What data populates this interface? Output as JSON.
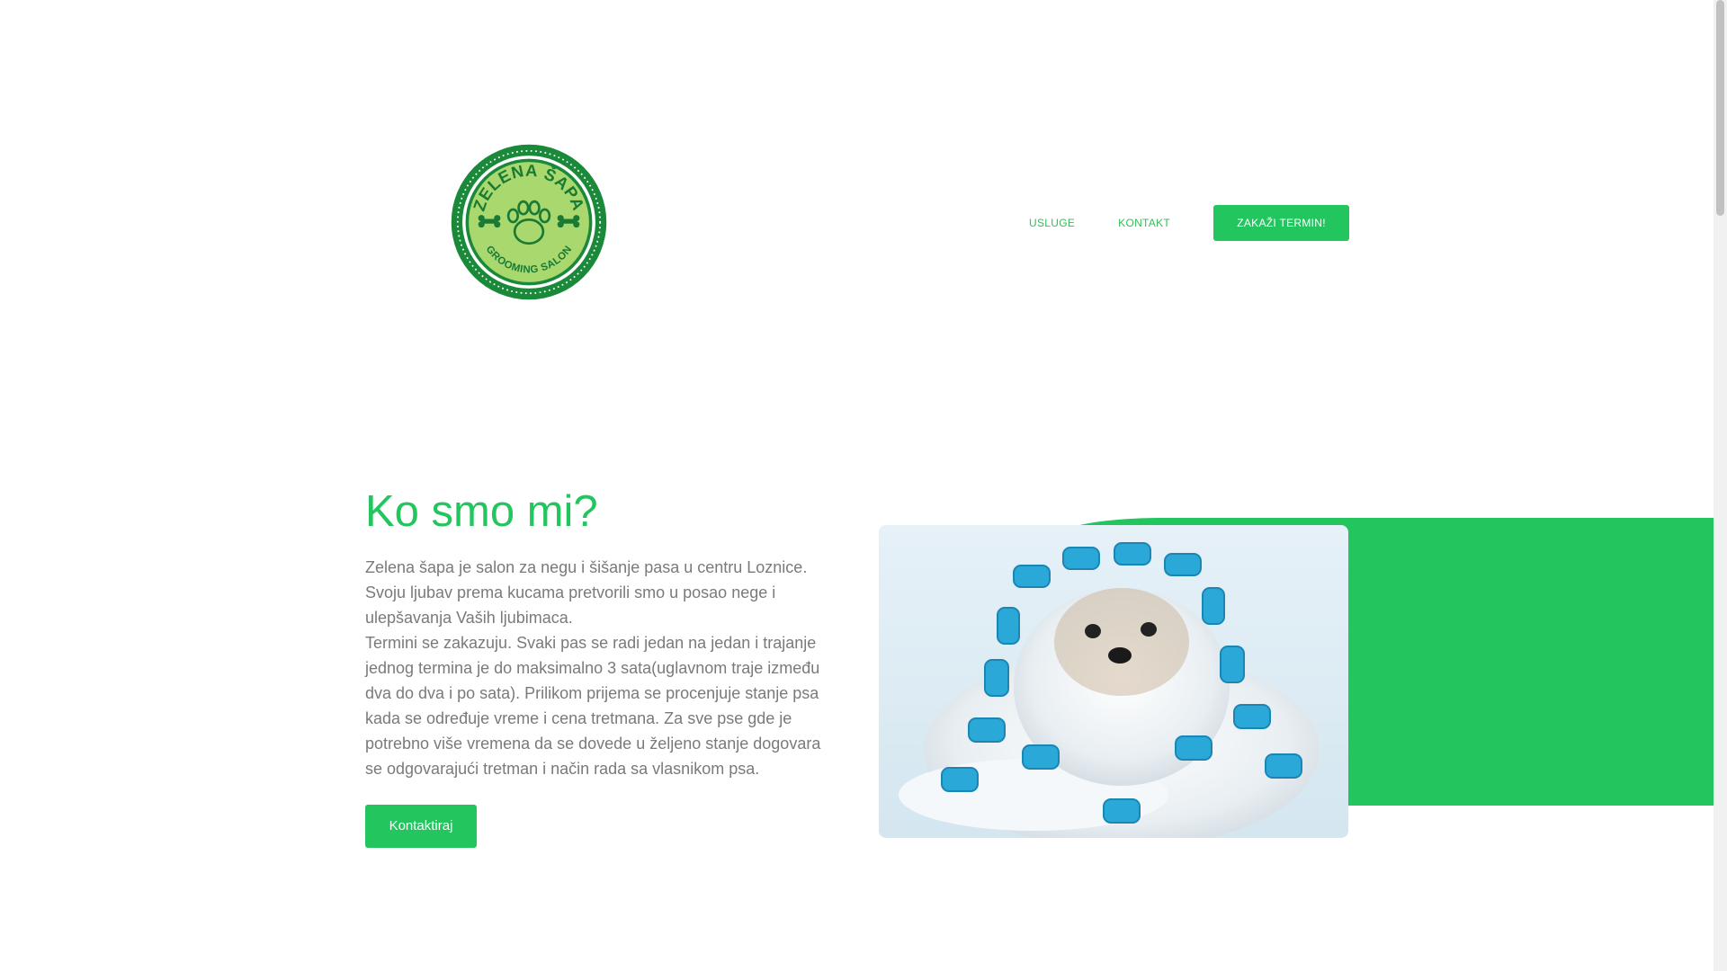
{
  "header": {
    "logo": {
      "icon": "paw-badge-icon",
      "text_top": "ZELENA ŠAPA",
      "text_bottom": "GROOMING SALON",
      "colors": {
        "ring": "#1a8a3a",
        "inner": "#a8d86e",
        "accent": "#1a7a34"
      }
    },
    "nav": {
      "items": [
        {
          "label": "USLUGE"
        },
        {
          "label": "KONTAKT"
        }
      ],
      "cta_label": "ZAKAŽI TERMIN!"
    }
  },
  "about": {
    "title": "Ko smo mi?",
    "paragraph_1": "Zelena šapa je salon za negu i šišanje pasa u centru Loznice. Svoju ljubav prema kucama pretvorili smo u posao nege i ulepšavanja Vaših ljubimaca.",
    "paragraph_2": "Termini se zakazuju. Svaki pas se radi jedan na jedan i trajanje jednog termina je do maksimalno 3 sata(uglavnom traje između dva do dva i po sata). Prilikom prijema se procenjuje stanje psa kada se određuje vreme i cena tretmana. Za sve pse gde je potrebno više vremena da se dovede u željeno stanje dogovara se odgovarajući tretman i način rada sa vlasnikom psa.",
    "button_label": "Kontaktiraj"
  },
  "colors": {
    "brand_green": "#22c55e",
    "text_gray": "#7a7a7a",
    "curler_blue": "#2aa8d8"
  }
}
